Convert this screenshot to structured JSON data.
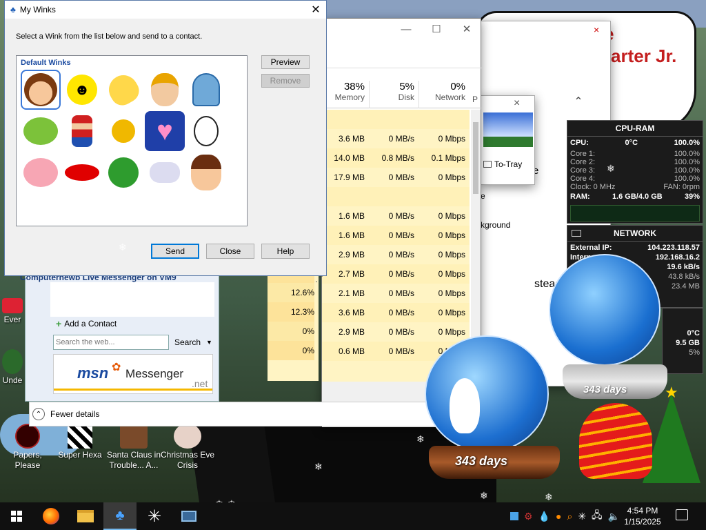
{
  "winks_dialog": {
    "title": "My Winks",
    "instruction": "Select a Wink from the list below and send to a contact.",
    "group_label": "Default Winks",
    "preview_label": "Preview",
    "remove_label": "Remove",
    "send_label": "Send",
    "close_label": "Close",
    "help_label": "Help"
  },
  "task_manager": {
    "columns": [
      {
        "percent": "38%",
        "label": "Memory"
      },
      {
        "percent": "5%",
        "label": "Disk"
      },
      {
        "percent": "0%",
        "label": "Network"
      },
      {
        "percent": "",
        "label": "P"
      }
    ],
    "rows": [
      {
        "cpu": "",
        "memory": "",
        "disk": "",
        "network": ""
      },
      {
        "cpu": "",
        "memory": "3.6 MB",
        "disk": "0 MB/s",
        "network": "0 Mbps"
      },
      {
        "cpu": "",
        "memory": "14.0 MB",
        "disk": "0.8 MB/s",
        "network": "0.1 Mbps"
      },
      {
        "cpu": "",
        "memory": "17.9 MB",
        "disk": "0 MB/s",
        "network": "0 Mbps"
      },
      {
        "cpu": "",
        "memory": "",
        "disk": "",
        "network": ""
      },
      {
        "cpu": "",
        "memory": "1.6 MB",
        "disk": "0 MB/s",
        "network": "0 Mbps"
      },
      {
        "cpu": "",
        "memory": "1.6 MB",
        "disk": "0 MB/s",
        "network": "0 Mbps"
      },
      {
        "cpu": "",
        "memory": "2.9 MB",
        "disk": "0 MB/s",
        "network": "0 Mbps"
      },
      {
        "cpu": "4.0%",
        "memory": "2.7 MB",
        "disk": "0 MB/s",
        "network": "0 Mbps"
      },
      {
        "cpu": "12.6%",
        "memory": "2.1 MB",
        "disk": "0 MB/s",
        "network": "0 Mbps"
      },
      {
        "cpu": "12.3%",
        "memory": "3.6 MB",
        "disk": "0 MB/s",
        "network": "0 Mbps"
      },
      {
        "cpu": "0%",
        "memory": "2.9 MB",
        "disk": "0 MB/s",
        "network": "0 Mbps"
      },
      {
        "cpu": "0%",
        "memory": "0.6 MB",
        "disk": "0 MB/s",
        "network": "0 Mbps"
      }
    ],
    "fewer_details": "Fewer details"
  },
  "side_window": {
    "tray_label": "To-Tray",
    "text_e1": "e",
    "text_e2": "e",
    "background_text": "kground",
    "instead_text": "stead"
  },
  "messenger": {
    "title": "Computernewb Live Messenger on VM9",
    "add_contact": "Add a Contact",
    "search_placeholder": "Search the web...",
    "search_button": "Search",
    "brand": "msn",
    "product": "Messenger",
    "net": ".net"
  },
  "header_text": {
    "line1": "e",
    "line2": "arter Jr."
  },
  "cpu_gadget": {
    "title": "CPU-RAM",
    "cpu_label": "CPU:",
    "cpu_temp": "0°C",
    "cpu_value": "100.0%",
    "cores": [
      {
        "label": "Core 1:",
        "value": "100.0%"
      },
      {
        "label": "Core 2:",
        "value": "100.0%"
      },
      {
        "label": "Core 3:",
        "value": "100.0%"
      },
      {
        "label": "Core 4:",
        "value": "100.0%"
      }
    ],
    "clock": "Clock: 0 MHz",
    "fan": "FAN: 0rpm",
    "ram_label": "RAM:",
    "ram_value": "1.6 GB/4.0 GB",
    "ram_percent": "39%"
  },
  "network_gadget": {
    "title": "NETWORK",
    "external_label": "External IP:",
    "external_value": "104.223.118.57",
    "internal_label": "Intern",
    "internal_value": "192.168.16.2",
    "up": "19.6 kB/s",
    "down": "43.8 kB/s",
    "total": "23.4 MB",
    "temp": "0°C",
    "gb": "9.5 GB",
    "gb_percent": "5%"
  },
  "globe": {
    "days1": "343 days",
    "days2": "343 days"
  },
  "desktop_icons": [
    {
      "label": "Ever"
    },
    {
      "label": "Unde"
    },
    {
      "label": "Papers, Please"
    },
    {
      "label": "Super Hexa"
    },
    {
      "label": "Santa Claus in Trouble... A..."
    },
    {
      "label": "Christmas Eve Crisis"
    }
  ],
  "taskbar": {
    "time": "4:54 PM",
    "date": "1/15/2025"
  },
  "colors": {
    "accent": "#0078d7",
    "heat_low": "#fff4c4",
    "heat_mid": "#fce9a6",
    "title_red": "#c41e1e"
  }
}
